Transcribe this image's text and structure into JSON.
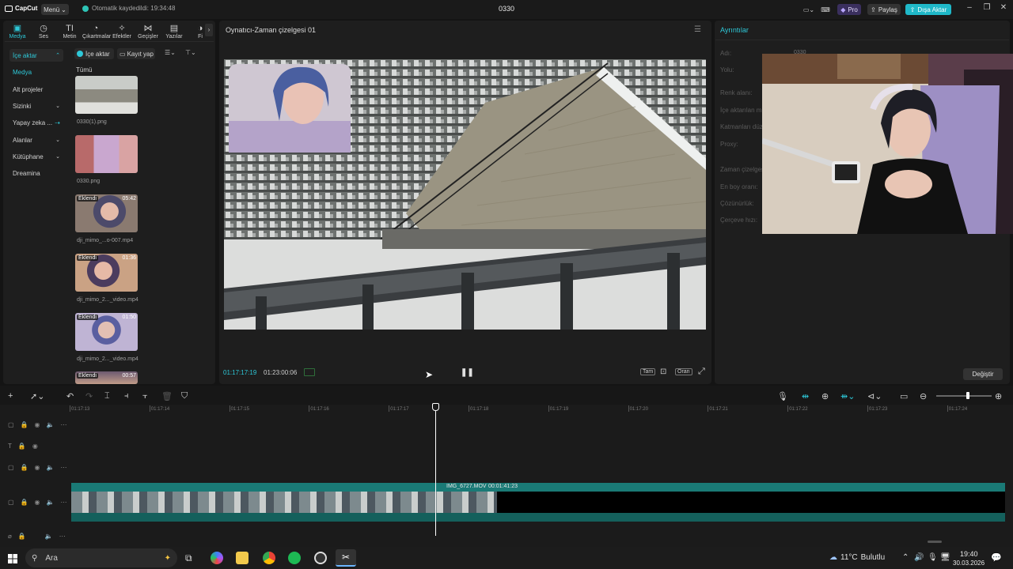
{
  "app": {
    "logo": "CapCut",
    "menu_label": "Menü",
    "autosave": "Otomatik kaydedildi: 19:34:48",
    "project_title": "0330",
    "pro_label": "Pro",
    "share_label": "Paylaş",
    "export_label": "Dışa Aktar"
  },
  "toolbar": {
    "tools": [
      {
        "label": "Medya",
        "icon": "media-icon"
      },
      {
        "label": "Ses",
        "icon": "audio-icon"
      },
      {
        "label": "Metin",
        "icon": "text-icon"
      },
      {
        "label": "Çıkartmalar",
        "icon": "sticker-icon"
      },
      {
        "label": "Efektler",
        "icon": "effects-icon"
      },
      {
        "label": "Geçişler",
        "icon": "transitions-icon"
      },
      {
        "label": "Yazılar",
        "icon": "captions-icon"
      },
      {
        "label": "Fi",
        "icon": "filter-icon"
      }
    ]
  },
  "sidebar": {
    "items": [
      {
        "label": "İçe aktar",
        "arrow": "⌃"
      },
      {
        "label": "Medya",
        "arrow": ""
      },
      {
        "label": "Alt projeler",
        "arrow": ""
      },
      {
        "label": "Sizinki",
        "arrow": "⌄"
      },
      {
        "label": "Yapay zeka ...",
        "arrow": ""
      },
      {
        "label": "Alanlar",
        "arrow": "⌄"
      },
      {
        "label": "Kütüphane",
        "arrow": "⌄"
      },
      {
        "label": "Dreamina",
        "arrow": ""
      }
    ]
  },
  "media": {
    "import_label": "İçe aktar",
    "record_label": "Kayıt yap",
    "filter_label": "Tümü",
    "items": [
      {
        "name": "0330(1).png",
        "badge": "",
        "duration": ""
      },
      {
        "name": "0330.png",
        "badge": "",
        "duration": ""
      },
      {
        "name": "dji_mimo_...o-007.mp4",
        "badge": "Eklendi",
        "duration": "05:42"
      },
      {
        "name": "dji_mimo_2..._video.mp4",
        "badge": "Eklendi",
        "duration": "01:36"
      },
      {
        "name": "dji_mimo_2..._video.mp4",
        "badge": "Eklendi",
        "duration": "01:50"
      },
      {
        "name": "",
        "badge": "Eklendi",
        "duration": "00:57"
      }
    ]
  },
  "player": {
    "title": "Oynatıcı-Zaman çizelgesi 01",
    "current_time": "01:17:17:19",
    "total_time": "01:23:00:06",
    "full_label": "Tam",
    "ratio_label": "Oran"
  },
  "details": {
    "title": "Ayrıntılar",
    "fields": [
      "Adı:",
      "Yolu:",
      "Renk alanı:",
      "İçe aktarılan m...",
      "Katmanları düz...",
      "Proxy:",
      "Zaman çizelgesi...",
      "En boy oranı:",
      "Çözünürlük:",
      "Çerçeve hızı:"
    ],
    "name_value": "0330",
    "change_label": "Değiştir"
  },
  "timeline": {
    "ticks": [
      "01:17:13",
      "01:17:14",
      "01:17:15",
      "01:17:16",
      "01:17:17",
      "01:17:18",
      "01:17:19",
      "01:17:20",
      "01:17:21",
      "01:17:22",
      "01:17:23",
      "01:17:24"
    ],
    "clip_label": "IMG_6727.MOV",
    "clip_duration": "00:01:41:23"
  },
  "taskbar": {
    "search_placeholder": "Ara",
    "weather_temp": "11°C",
    "weather_text": "Bulutlu",
    "clock_time": "19:40",
    "clock_date": "30.03.2026"
  },
  "colors": {
    "accent": "#2ec8d8",
    "export_bg": "#1fb8c8",
    "clip_teal": "#1a7a76",
    "playhead": "#ffffff"
  }
}
